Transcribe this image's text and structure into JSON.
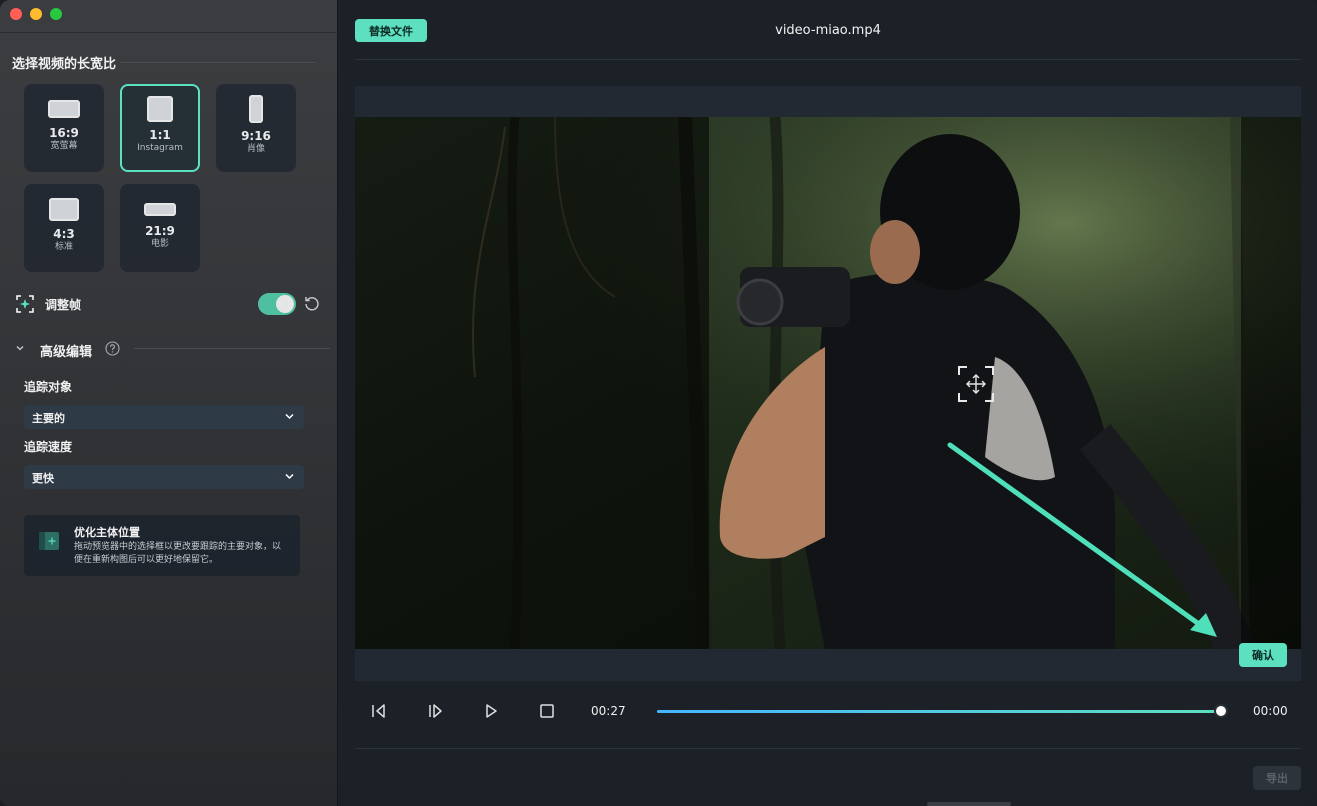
{
  "sidebar": {
    "aspect_title": "选择视频的长宽比",
    "ratios": [
      {
        "value": "16:9",
        "desc": "宽萤幕",
        "selected": false
      },
      {
        "value": "1:1",
        "desc": "Instagram",
        "selected": true
      },
      {
        "value": "9:16",
        "desc": "肖像",
        "selected": false
      },
      {
        "value": "4:3",
        "desc": "标准",
        "selected": false
      },
      {
        "value": "21:9",
        "desc": "电影",
        "selected": false
      }
    ],
    "adjust_frame": {
      "label": "调整帧",
      "enabled": true
    },
    "advanced": {
      "label": "高级编辑",
      "track_object_label": "追踪对象",
      "track_object_value": "主要的",
      "track_speed_label": "追踪速度",
      "track_speed_value": "更快"
    },
    "tip": {
      "title": "优化主体位置",
      "body": "拖动预览器中的选择框以更改要跟踪的主要对象，以便在重新构图后可以更好地保留它。"
    }
  },
  "main": {
    "replace_label": "替换文件",
    "filename": "video-miao.mp4",
    "confirm_label": "确认",
    "player": {
      "current_time": "00:27",
      "end_time": "00:00",
      "progress": 1.0
    },
    "export_label": "导出"
  },
  "colors": {
    "accent": "#5de0c0",
    "progress_start": "#44b6ff",
    "toggle_on": "#4fbfa2"
  },
  "icons": {
    "prev_frame": "step-back-icon",
    "next_frame": "step-forward-icon",
    "play": "play-icon",
    "stop": "stop-icon",
    "focus": "focus-move-icon"
  }
}
